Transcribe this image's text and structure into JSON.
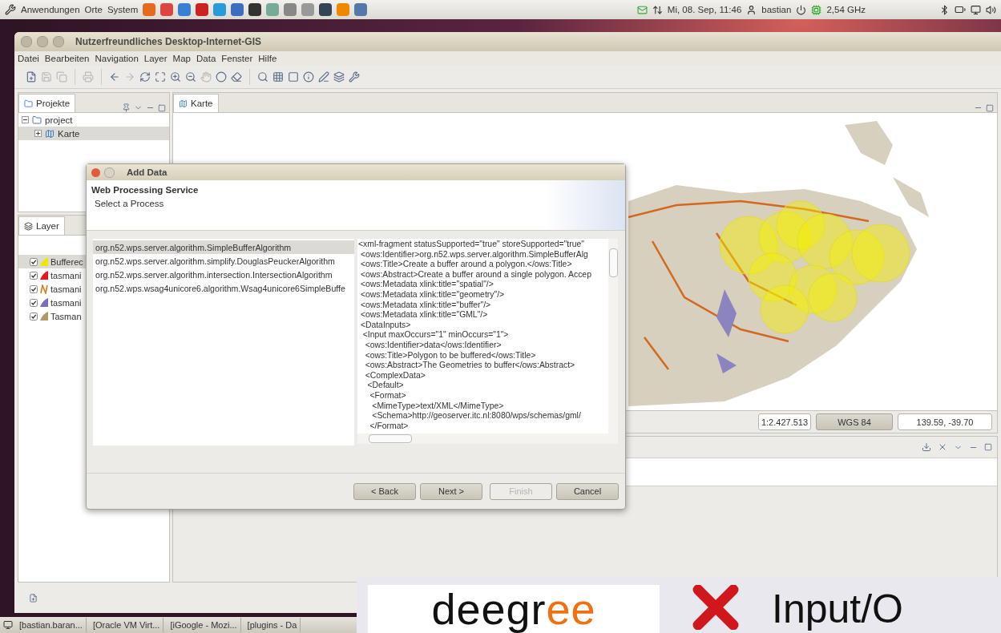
{
  "top_panel": {
    "menus": [
      "Anwendungen",
      "Orte",
      "System"
    ],
    "clock": "Mi, 08. Sep, 11:46",
    "user": "bastian",
    "cpu": "2,54 GHz"
  },
  "window": {
    "title": "Nutzerfreundliches Desktop-Internet-GIS",
    "menu": [
      "Datei",
      "Bearbeiten",
      "Navigation",
      "Layer",
      "Map",
      "Data",
      "Fenster",
      "Hilfe"
    ]
  },
  "projects_panel": {
    "tab": "Projekte",
    "tree": [
      {
        "label": "project",
        "expanded": true,
        "selected": false,
        "children": [
          {
            "label": "Karte",
            "expanded": false,
            "selected": true
          }
        ]
      }
    ]
  },
  "layer_panel": {
    "tab": "Layer",
    "layers": [
      {
        "label": "Bufferec",
        "kind": "polygon",
        "color": "#f2e600",
        "checked": true,
        "selected": true
      },
      {
        "label": "tasmani",
        "kind": "polygon",
        "color": "#e8141e",
        "checked": true,
        "selected": false
      },
      {
        "label": "tasmani",
        "kind": "line",
        "color": "#e07a10",
        "checked": true,
        "selected": false
      },
      {
        "label": "tasmani",
        "kind": "polygon",
        "color": "#7a6cc0",
        "checked": true,
        "selected": false
      },
      {
        "label": "Tasman",
        "kind": "polygon",
        "color": "#b09a68",
        "checked": true,
        "selected": false
      }
    ]
  },
  "map_editor": {
    "tab": "Karte",
    "scale": "1:2.427.513",
    "crs": "WGS 84",
    "coords": "139.59, -39.70"
  },
  "dialog": {
    "title": "Add Data",
    "heading": "Web Processing Service",
    "subheading": "Select a Process",
    "processes": [
      {
        "label": "org.n52.wps.server.algorithm.SimpleBufferAlgorithm",
        "selected": true
      },
      {
        "label": "org.n52.wps.server.algorithm.simplify.DouglasPeuckerAlgorithm",
        "selected": false
      },
      {
        "label": "org.n52.wps.server.algorithm.intersection.IntersectionAlgorithm",
        "selected": false
      },
      {
        "label": "org.n52.wps.wsag4unicore6.algorithm.Wsag4unicore6SimpleBuffe",
        "selected": false
      }
    ],
    "xml_lines": [
      "<xml-fragment statusSupported=\"true\" storeSupported=\"true\"",
      " <ows:Identifier>org.n52.wps.server.algorithm.SimpleBufferAlg",
      " <ows:Title>Create a buffer around a polygon.</ows:Title>",
      " <ows:Abstract>Create a buffer around a single polygon. Accep",
      " <ows:Metadata xlink:title=\"spatial\"/>",
      " <ows:Metadata xlink:title=\"geometry\"/>",
      " <ows:Metadata xlink:title=\"buffer\"/>",
      " <ows:Metadata xlink:title=\"GML\"/>",
      " <DataInputs>",
      "  <Input maxOccurs=\"1\" minOccurs=\"1\">",
      "   <ows:Identifier>data</ows:Identifier>",
      "   <ows:Title>Polygon to be buffered</ows:Title>",
      "   <ows:Abstract>The Geometries to buffer</ows:Abstract>",
      "   <ComplexData>",
      "    <Default>",
      "     <Format>",
      "      <MimeType>text/XML</MimeType>",
      "      <Schema>http://geoserver.itc.nl:8080/wps/schemas/gml/",
      "     </Format>"
    ],
    "buttons": [
      {
        "label": "< Back",
        "disabled": false
      },
      {
        "label": "Next >",
        "disabled": false
      },
      {
        "label": "Finish",
        "disabled": true
      },
      {
        "label": "Cancel",
        "disabled": false
      }
    ]
  },
  "taskbar": {
    "items": [
      "[bastian.baran...",
      "[Oracle VM Virt...",
      "[iGoogle - Mozi...",
      "[plugins - Da"
    ]
  },
  "overlay": {
    "logo": "deegree",
    "caption": "Input/O"
  }
}
